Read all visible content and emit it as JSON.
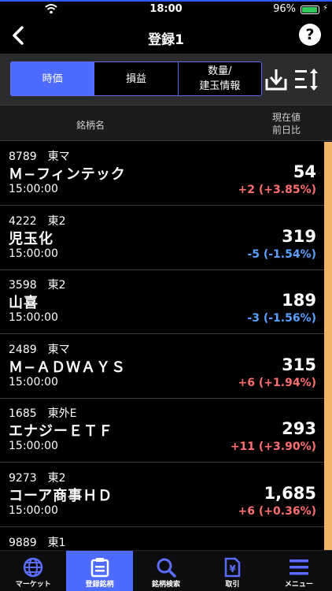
{
  "status": {
    "time": "18:00",
    "battery": "96%"
  },
  "nav": {
    "title": "登録1"
  },
  "segments": [
    {
      "label": "時価",
      "active": true
    },
    {
      "label": "損益",
      "active": false
    },
    {
      "label": "数量/",
      "label2": "建玉情報",
      "active": false
    }
  ],
  "header": {
    "left": "銘柄名",
    "right1": "現在値",
    "right2": "前日比"
  },
  "rows": [
    {
      "code": "8789　東マ",
      "name": "Ｍ−フィンテック",
      "time": "15:00:00",
      "price": "54",
      "change": "+2 (+3.85%)",
      "dir": "up"
    },
    {
      "code": "4222　東2",
      "name": "児玉化",
      "time": "15:00:00",
      "price": "319",
      "change": "-5 (-1.54%)",
      "dir": "down"
    },
    {
      "code": "3598　東2",
      "name": "山喜",
      "time": "15:00:00",
      "price": "189",
      "change": "-3 (-1.56%)",
      "dir": "down"
    },
    {
      "code": "2489　東マ",
      "name": "Ｍ−ＡＤＷＡＹＳ",
      "time": "15:00:00",
      "price": "315",
      "change": "+6 (+1.94%)",
      "dir": "up"
    },
    {
      "code": "1685　東外E",
      "name": "エナジーＥＴＦ",
      "time": "15:00:00",
      "price": "293",
      "change": "+11 (+3.90%)",
      "dir": "up"
    },
    {
      "code": "9273　東2",
      "name": "コーア商事ＨＤ",
      "time": "15:00:00",
      "price": "1,685",
      "change": "+6 (+0.36%)",
      "dir": "up"
    },
    {
      "code": "9889　東1",
      "name": "",
      "time": "",
      "price": "",
      "change": "",
      "dir": "up"
    }
  ],
  "tabbar": [
    {
      "label": "マーケット",
      "icon": "globe-icon"
    },
    {
      "label": "登録銘柄",
      "icon": "clipboard-icon",
      "active": true
    },
    {
      "label": "銘柄検索",
      "icon": "search-icon"
    },
    {
      "label": "取引",
      "icon": "yen-document-icon"
    },
    {
      "label": "メニュー",
      "icon": "menu-icon"
    }
  ],
  "colors": {
    "accent": "#4e6bff",
    "up": "#ff6f6f",
    "down": "#5aa0ff",
    "scrollbar": "#f2b467"
  }
}
